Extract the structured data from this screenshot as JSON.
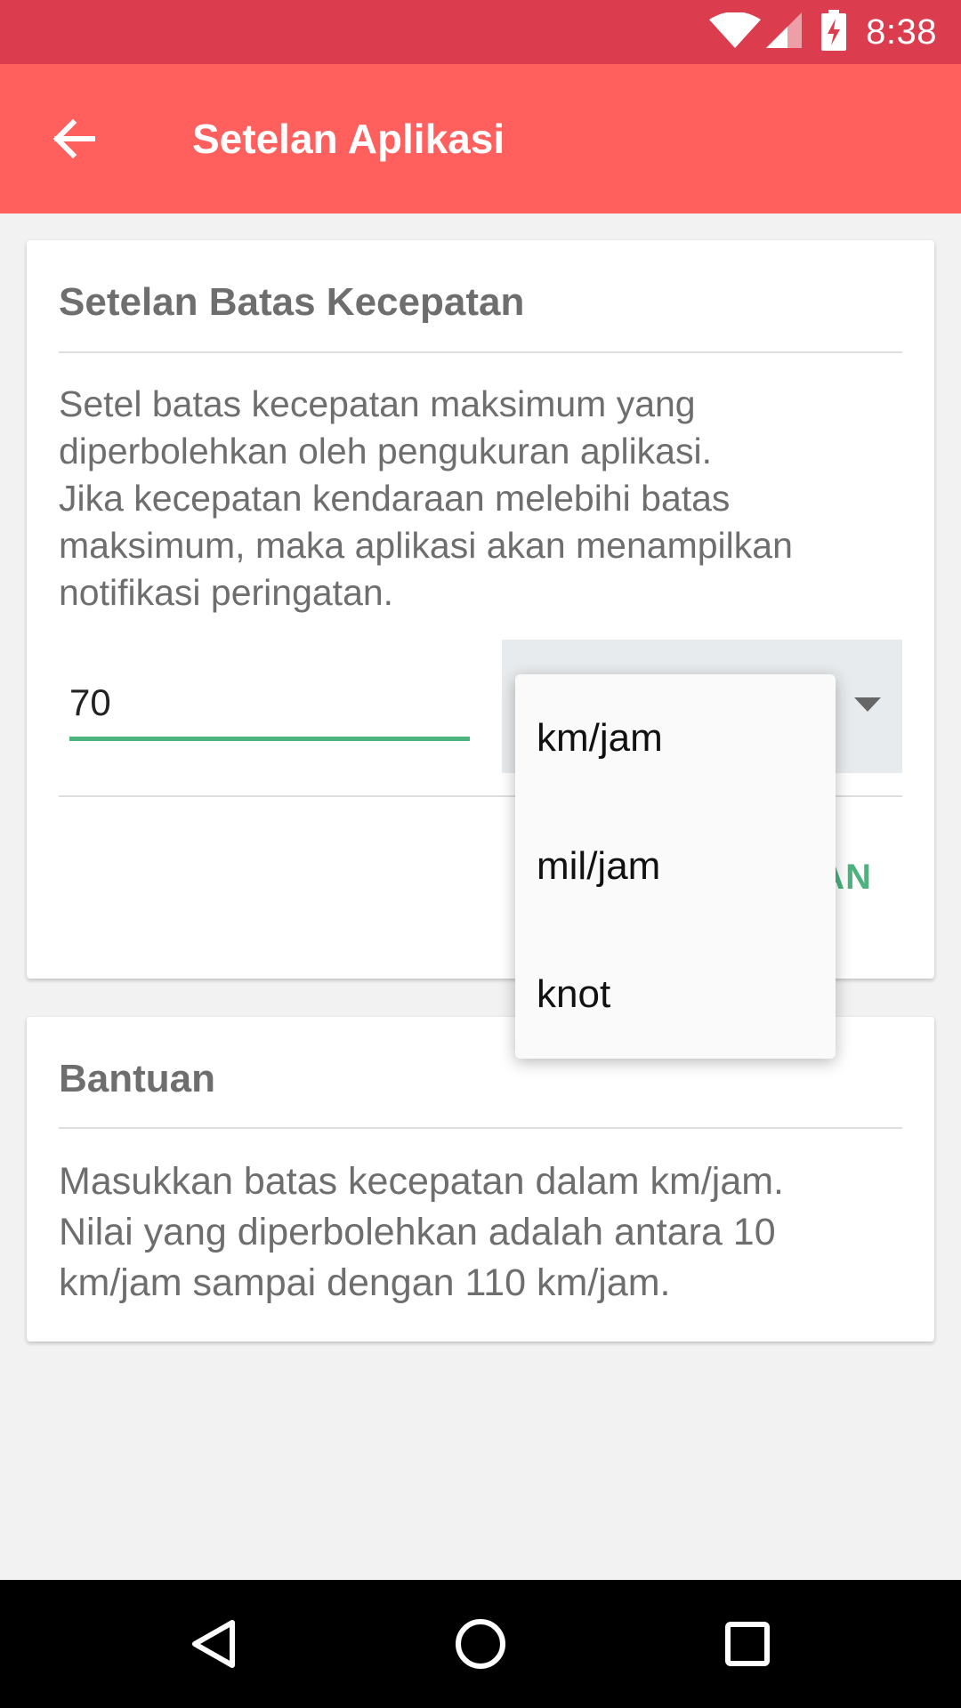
{
  "status_bar": {
    "time": "8:38",
    "icons": [
      "wifi-icon",
      "signal-icon",
      "battery-charging-icon"
    ],
    "color": "#dc3d4e"
  },
  "app_bar": {
    "title": "Setelan Aplikasi",
    "back_icon": "arrow-left-icon",
    "color": "#ff5f5d"
  },
  "speed_card": {
    "title": "Setelan Batas Kecepatan",
    "description": [
      "Setel batas kecepatan maksimum yang",
      "diperbolehkan oleh pengukuran aplikasi.",
      "Jika kecepatan kendaraan melebihi batas",
      "maksimum, maka aplikasi akan menampilkan",
      "notifikasi peringatan."
    ],
    "speed_value": "70",
    "save_label_visible": "AN",
    "accent_color": "#4cb37f"
  },
  "unit_dropdown": {
    "options": [
      "km/jam",
      "mil/jam",
      "knot"
    ]
  },
  "help_card": {
    "title": "Bantuan",
    "description": [
      "Masukkan batas kecepatan dalam km/jam.",
      "Nilai yang diperbolehkan adalah antara 10",
      "km/jam sampai dengan 110 km/jam."
    ]
  },
  "nav_bar": {
    "buttons": [
      "back-triangle-icon",
      "home-circle-icon",
      "recents-square-icon"
    ]
  }
}
